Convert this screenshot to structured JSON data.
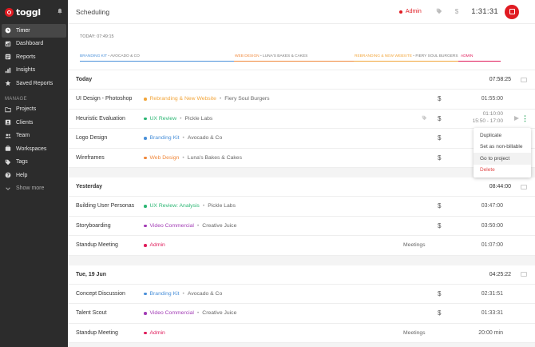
{
  "sidebar": {
    "brand": "toggl",
    "items": [
      {
        "label": "Timer",
        "icon": "clock-icon",
        "active": true
      },
      {
        "label": "Dashboard",
        "icon": "dashboard-icon"
      },
      {
        "label": "Reports",
        "icon": "reports-icon"
      },
      {
        "label": "Insights",
        "icon": "insights-icon"
      },
      {
        "label": "Saved Reports",
        "icon": "star-icon"
      }
    ],
    "manage_label": "MANAGE",
    "manage_items": [
      {
        "label": "Projects",
        "icon": "folder-icon"
      },
      {
        "label": "Clients",
        "icon": "clients-icon"
      },
      {
        "label": "Team",
        "icon": "team-icon"
      },
      {
        "label": "Workspaces",
        "icon": "workspaces-icon"
      },
      {
        "label": "Tags",
        "icon": "tag-icon"
      },
      {
        "label": "Help",
        "icon": "help-icon"
      }
    ],
    "show_more": "Show more"
  },
  "header": {
    "title": "Scheduling",
    "current_project": "Admin",
    "timer": "1:31:31"
  },
  "timeline": {
    "today": "TODAY: 07:49:15",
    "segments": [
      {
        "project": "BRANDING KIT",
        "client": "AVOCADO & CO",
        "color": "#4a90d9"
      },
      {
        "project": "WEB DESIGN",
        "client": "LUNA'S BAKES & CAKES",
        "color": "#f0883b"
      },
      {
        "project": "REBRANDING & NEW WEBSITE",
        "client": "FIERY SOUL BURGERS",
        "color": "#f2a53a"
      },
      {
        "project": "ADMIN",
        "client": "",
        "color": "#e01b5a"
      }
    ]
  },
  "groups": [
    {
      "title": "Today",
      "total": "07:58:25",
      "entries": [
        {
          "desc": "UI Design - Photoshop",
          "project": "Rebranding & New Website",
          "client": "Fiery Soul Burgers",
          "color": "#f2a53a",
          "billable": true,
          "duration": "01:55:00"
        },
        {
          "desc": "Heuristic Evaluation",
          "project": "UX Review",
          "client": "Pickle Labs",
          "color": "#2bb673",
          "billable": true,
          "duration": "01:10:00",
          "range": "15:50 - 17:00",
          "hovered": true
        },
        {
          "desc": "Logo Design",
          "project": "Branding Kit",
          "client": "Avocado & Co",
          "color": "#4a90d9",
          "billable": true,
          "duration": ""
        },
        {
          "desc": "Wireframes",
          "project": "Web Design",
          "client": "Luna's Bakes & Cakes",
          "color": "#f0883b",
          "billable": true,
          "duration": ""
        }
      ]
    },
    {
      "title": "Yesterday",
      "total": "08:44:00",
      "entries": [
        {
          "desc": "Building User Personas",
          "project": "UX Review: Analysis",
          "client": "Pickle Labs",
          "color": "#2bb673",
          "billable": true,
          "duration": "03:47:00"
        },
        {
          "desc": "Storyboarding",
          "project": "Video Commercial",
          "client": "Creative Juice",
          "color": "#a23bb5",
          "billable": true,
          "duration": "03:50:00"
        },
        {
          "desc": "Standup Meeting",
          "project": "Admin",
          "client": "",
          "color": "#e01b5a",
          "billable": false,
          "tag": "Meetings",
          "duration": "01:07:00"
        }
      ]
    },
    {
      "title": "Tue, 19 Jun",
      "total": "04:25:22",
      "entries": [
        {
          "desc": "Concept Discussion",
          "project": "Branding Kit",
          "client": "Avocado & Co",
          "color": "#4a90d9",
          "billable": true,
          "duration": "02:31:51"
        },
        {
          "desc": "Talent Scout",
          "project": "Video Commercial",
          "client": "Creative Juice",
          "color": "#a23bb5",
          "billable": true,
          "duration": "01:33:31"
        },
        {
          "desc": "Standup Meeting",
          "project": "Admin",
          "client": "",
          "color": "#e01b5a",
          "billable": false,
          "tag": "Meetings",
          "duration": "20:00 min"
        }
      ]
    }
  ],
  "context_menu": {
    "items": [
      "Duplicate",
      "Set as non-billable",
      "Go to project",
      "Delete"
    ]
  }
}
